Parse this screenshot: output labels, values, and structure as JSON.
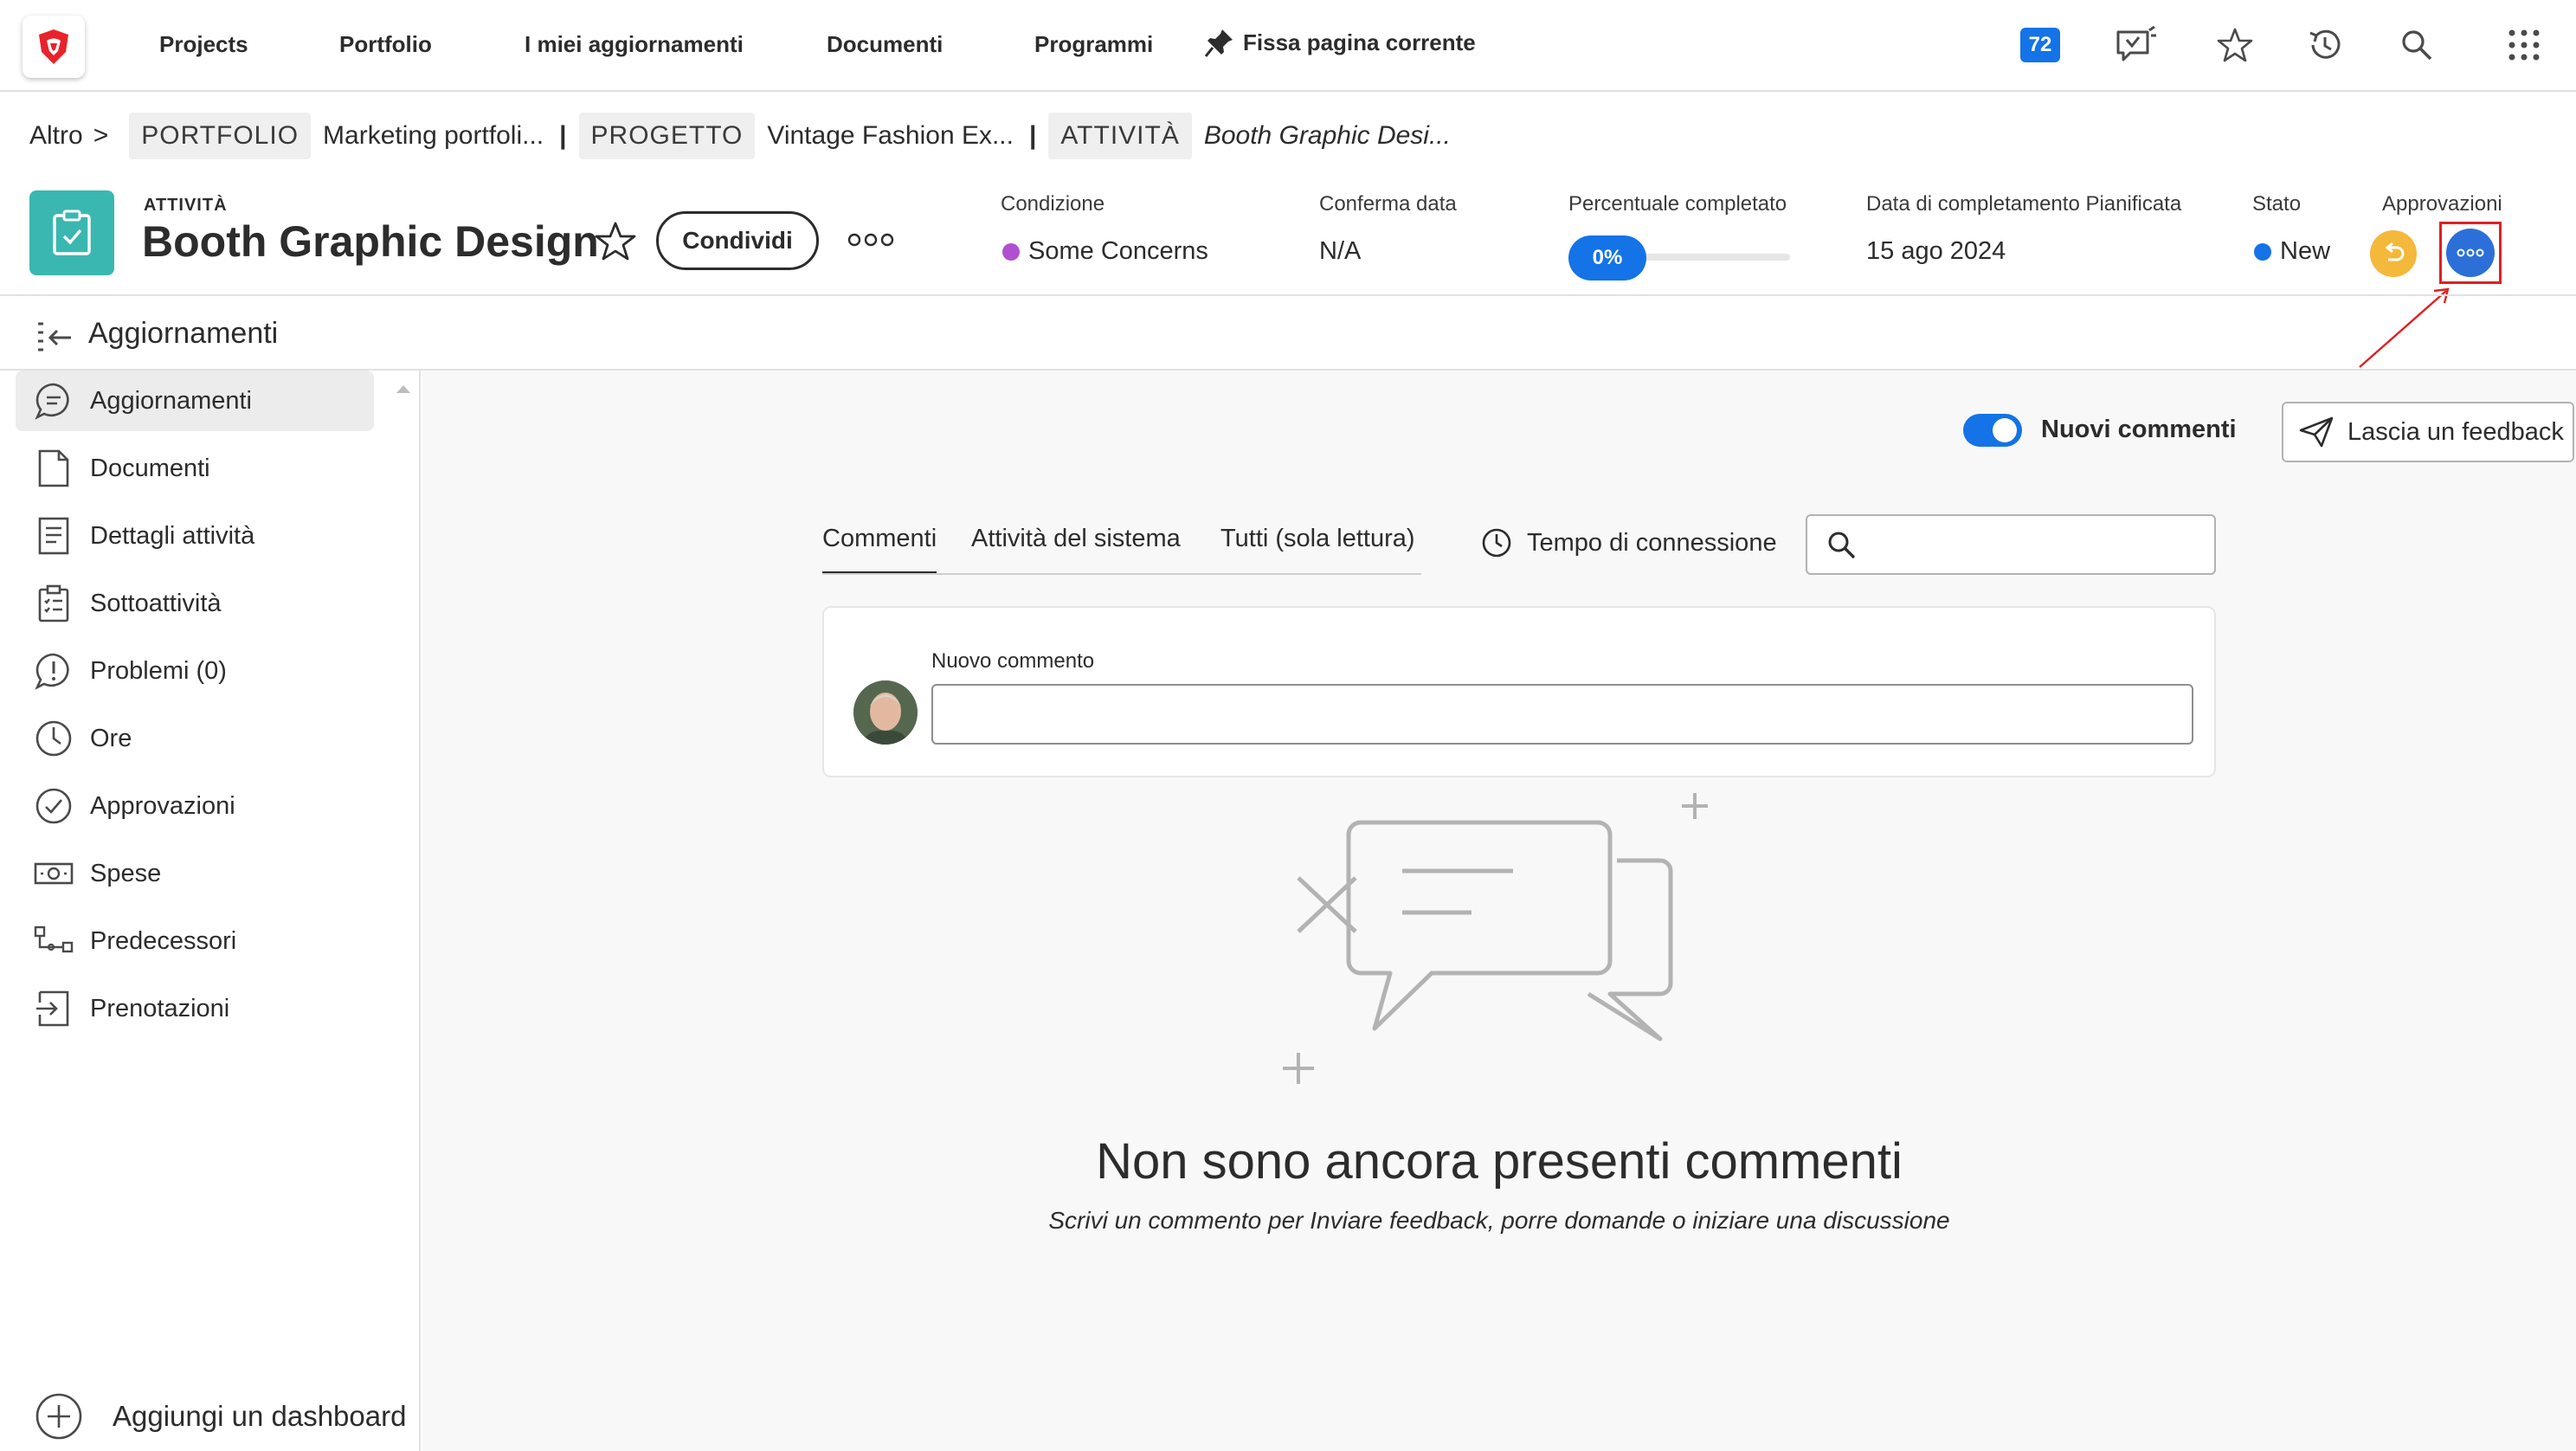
{
  "topnav": {
    "links": [
      "Projects",
      "Portfolio",
      "I miei aggiornamenti",
      "Documenti",
      "Programmi"
    ],
    "pin_label": "Fissa pagina corrente",
    "notifications_count": "72"
  },
  "breadcrumb": {
    "more": "Altro",
    "more_sep": ">",
    "portfolio_tag": "PORTFOLIO",
    "portfolio_name": "Marketing portfoli...",
    "project_tag": "PROGETTO",
    "project_name": "Vintage Fashion Ex...",
    "task_tag": "ATTIVITÀ",
    "task_name": "Booth Graphic Desi...",
    "separator": "|"
  },
  "header": {
    "object_type": "ATTIVITÀ",
    "title": "Booth Graphic Design",
    "share_label": "Condividi",
    "fields": {
      "condition_label": "Condizione",
      "condition_value": "Some Concerns",
      "condition_color": "#b04fd1",
      "commit_label": "Conferma data",
      "commit_value": "N/A",
      "percent_label": "Percentuale completato",
      "percent_value": "0%",
      "percent_fraction": 0,
      "planned_label": "Data di completamento Pianificata",
      "planned_value": "15 ago 2024",
      "status_label": "Stato",
      "status_value": "New",
      "status_color": "#1473e6",
      "approvals_label": "Approvazioni"
    }
  },
  "subheader": {
    "title": "Aggiornamenti"
  },
  "sidebar": {
    "items": [
      {
        "label": "Aggiornamenti",
        "icon": "chat-bubble-icon",
        "active": true
      },
      {
        "label": "Documenti",
        "icon": "document-icon"
      },
      {
        "label": "Dettagli attività",
        "icon": "details-icon"
      },
      {
        "label": "Sottoattività",
        "icon": "subtasks-icon"
      },
      {
        "label": "Problemi (0)",
        "icon": "issue-icon"
      },
      {
        "label": "Ore",
        "icon": "clock-icon"
      },
      {
        "label": "Approvazioni",
        "icon": "checkmark-circle-icon"
      },
      {
        "label": "Spese",
        "icon": "money-icon"
      },
      {
        "label": "Predecessori",
        "icon": "predecessor-icon"
      },
      {
        "label": "Prenotazioni",
        "icon": "booking-icon"
      }
    ],
    "add_dashboard": "Aggiungi un dashboard"
  },
  "main": {
    "toggle_label": "Nuovi commenti",
    "toggle_on": true,
    "feedback_label": "Lascia un feedback",
    "tabs": [
      "Commenti",
      "Attività del sistema",
      "Tutti (sola lettura)"
    ],
    "connection_time": "Tempo di connessione",
    "search_placeholder": "",
    "new_comment_label": "Nuovo commento",
    "empty_title": "Non sono ancora presenti commenti",
    "empty_subtitle": "Scrivi un commento per Inviare feedback, porre domande o iniziare una discussione"
  }
}
